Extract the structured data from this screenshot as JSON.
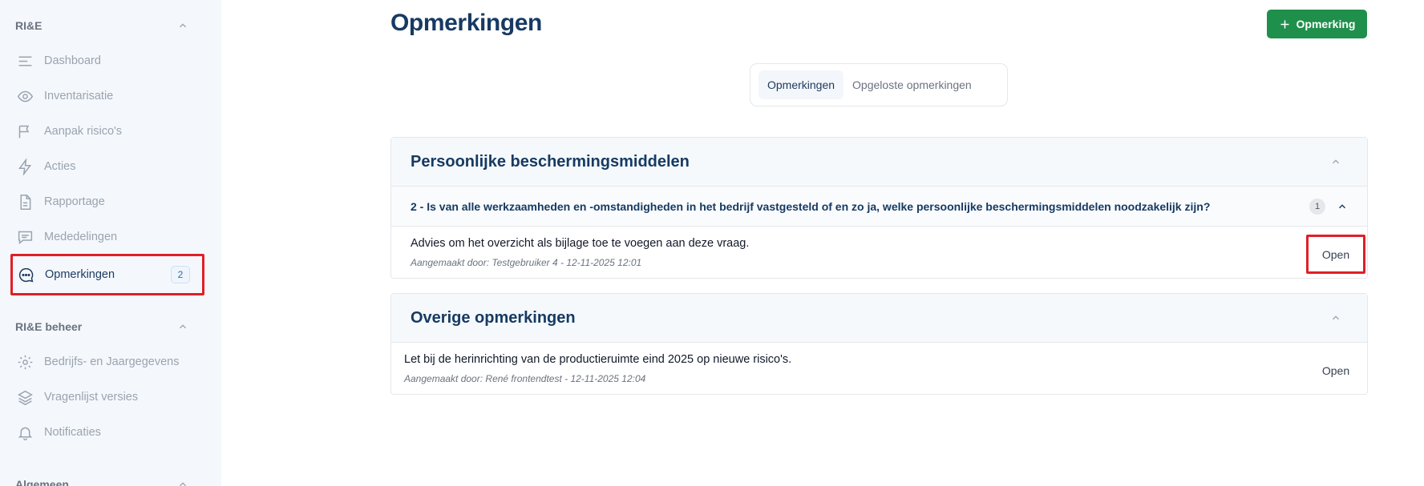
{
  "sidebar": {
    "groups": [
      {
        "title": "RI&E"
      },
      {
        "title": "RI&E beheer"
      },
      {
        "title": "Algemeen"
      }
    ],
    "items": [
      {
        "label": "Dashboard",
        "icon": "menu-lines-icon"
      },
      {
        "label": "Inventarisatie",
        "icon": "eye-icon"
      },
      {
        "label": "Aanpak risico's",
        "icon": "flag-icon"
      },
      {
        "label": "Acties",
        "icon": "lightning-icon"
      },
      {
        "label": "Rapportage",
        "icon": "document-icon"
      },
      {
        "label": "Mededelingen",
        "icon": "message-square-icon"
      },
      {
        "label": "Opmerkingen",
        "icon": "chat-bubble-dots-icon",
        "badge": "2",
        "active": true
      }
    ],
    "beheer_items": [
      {
        "label": "Bedrijfs- en Jaargegevens",
        "icon": "gear-icon"
      },
      {
        "label": "Vragenlijst versies",
        "icon": "layers-icon"
      },
      {
        "label": "Notificaties",
        "icon": "bell-icon"
      }
    ]
  },
  "main": {
    "title": "Opmerkingen",
    "add_button": "Opmerking",
    "tabs": [
      {
        "label": "Opmerkingen",
        "active": true
      },
      {
        "label": "Opgeloste opmerkingen",
        "active": false
      }
    ],
    "sections": [
      {
        "title": "Persoonlijke beschermingsmiddelen",
        "question": "2 - Is van alle werkzaamheden en -omstandigheden in het bedrijf vastgesteld of en zo ja, welke persoonlijke beschermingsmiddelen noodzakelijk zijn?",
        "count": "1",
        "comment": {
          "text": "Advies om het overzicht als bijlage toe te voegen aan deze vraag.",
          "meta": "Aangemaakt door: Testgebruiker 4 - 12-11-2025 12:01",
          "action": "Open"
        }
      },
      {
        "title": "Overige opmerkingen",
        "comment": {
          "text": "Let bij de herinrichting van de productieruimte eind 2025 op nieuwe risico's.",
          "meta": "Aangemaakt door: René frontendtest - 12-11-2025 12:04",
          "action": "Open"
        }
      }
    ]
  },
  "colors": {
    "primary_navy": "#173a62",
    "add_button_green": "#1f8f4c",
    "highlight_red": "#e01f26",
    "sidebar_bg": "#f4f8fc"
  }
}
